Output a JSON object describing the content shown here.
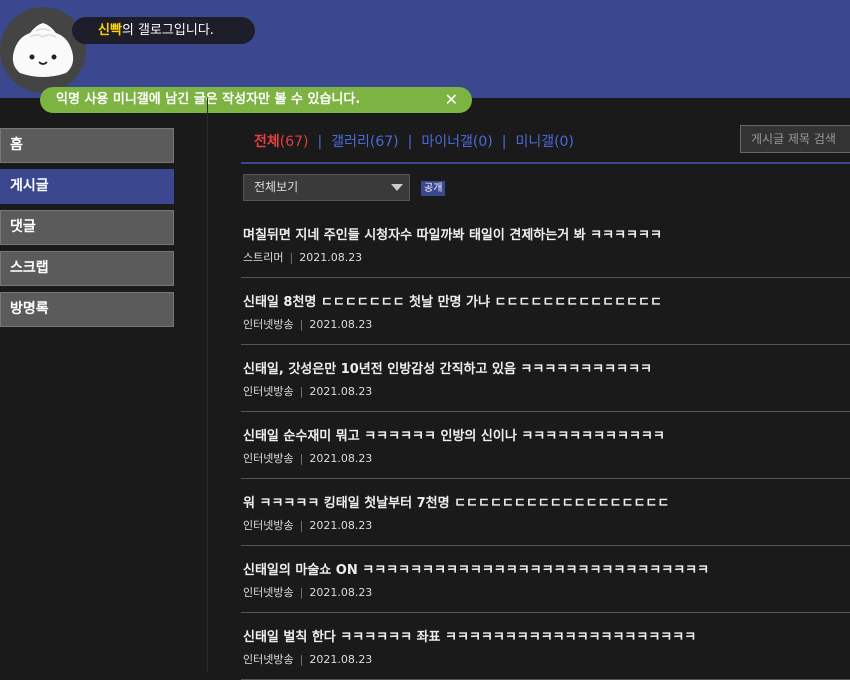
{
  "header": {
    "nickname": "신빡",
    "gallog_suffix": "의 갤로그입니다.",
    "notice": "익명 사용 미니갤에 남긴 글은 작성자만 볼 수 있습니다.",
    "notice_close": "✕"
  },
  "sidebar": {
    "items": [
      {
        "label": "홈"
      },
      {
        "label": "게시글"
      },
      {
        "label": "댓글"
      },
      {
        "label": "스크랩"
      },
      {
        "label": "방명록"
      }
    ]
  },
  "tabs": [
    {
      "label": "전체",
      "count": "(67)"
    },
    {
      "label": "갤러리",
      "count": "(67)"
    },
    {
      "label": "마이너갤",
      "count": "(0)"
    },
    {
      "label": "미니갤",
      "count": "(0)"
    }
  ],
  "tab_separator": "|",
  "search": {
    "placeholder": "게시글 제목 검색"
  },
  "filter": {
    "selected": "전체보기",
    "badge": "공개"
  },
  "posts": [
    {
      "title": "며칠뒤면 지네 주인들 시청자수 따일까봐 태일이 견제하는거 봐 ㅋㅋㅋㅋㅋㅋ",
      "gallery": "스트리머",
      "date": "2021.08.23"
    },
    {
      "title": "신태일 8천명 ㄷㄷㄷㄷㄷㄷㄷ 첫날 만명 가냐 ㄷㄷㄷㄷㄷㄷㄷㄷㄷㄷㄷㄷㄷㄷ",
      "gallery": "인터넷방송",
      "date": "2021.08.23"
    },
    {
      "title": "신태일, 갓성은만 10년전 인방감성 간직하고 있음 ㅋㅋㅋㅋㅋㅋㅋㅋㅋㅋㅋ",
      "gallery": "인터넷방송",
      "date": "2021.08.23"
    },
    {
      "title": "신태일 순수재미 뭐고 ㅋㅋㅋㅋㅋㅋ 인방의 신이나 ㅋㅋㅋㅋㅋㅋㅋㅋㅋㅋㅋㅋ",
      "gallery": "인터넷방송",
      "date": "2021.08.23"
    },
    {
      "title": "워 ㅋㅋㅋㅋㅋ 킹태일 첫날부터 7천명 ㄷㄷㄷㄷㄷㄷㄷㄷㄷㄷㄷㄷㄷㄷㄷㄷㄷㄷ",
      "gallery": "인터넷방송",
      "date": "2021.08.23"
    },
    {
      "title": "신태일의 마술쇼 ON ㅋㅋㅋㅋㅋㅋㅋㅋㅋㅋㅋㅋㅋㅋㅋㅋㅋㅋㅋㅋㅋㅋㅋㅋㅋㅋㅋㅋㅋ",
      "gallery": "인터넷방송",
      "date": "2021.08.23"
    },
    {
      "title": "신태일 벌칙 한다 ㅋㅋㅋㅋㅋㅋ 좌표 ㅋㅋㅋㅋㅋㅋㅋㅋㅋㅋㅋㅋㅋㅋㅋㅋㅋㅋㅋㅋㅋ",
      "gallery": "인터넷방송",
      "date": "2021.08.23"
    }
  ],
  "colors": {
    "header": "#3b4890",
    "active_tab": "#e04040",
    "tab": "#4a6bd8",
    "nickname": "#ffd400",
    "notice": "#7cb342"
  }
}
